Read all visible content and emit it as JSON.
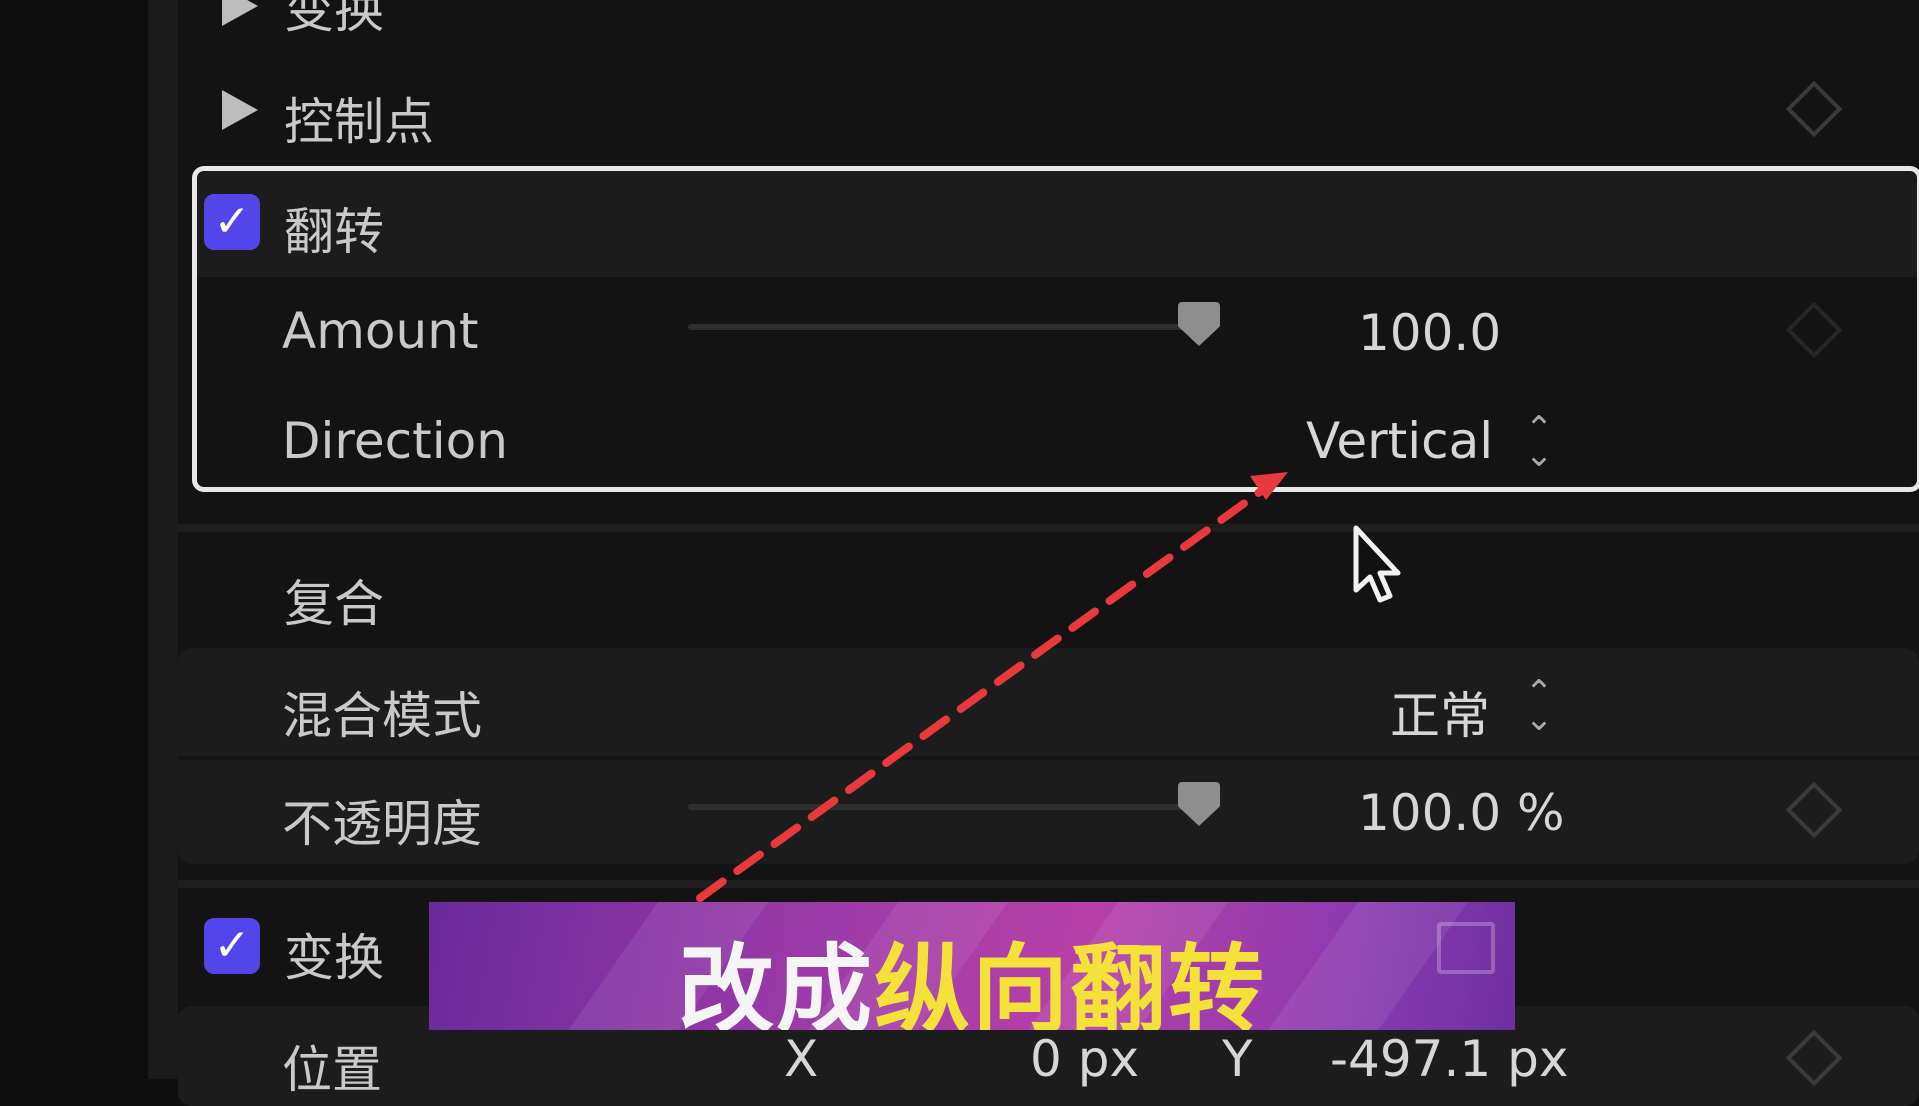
{
  "inspector": {
    "transform_top_label": "变换",
    "control_points_label": "控制点",
    "flip": {
      "title": "翻转",
      "checked": true,
      "amount": {
        "label": "Amount",
        "value": "100.0",
        "slider_level": 1.0
      },
      "direction": {
        "label": "Direction",
        "value": "Vertical"
      }
    },
    "composite": {
      "title": "复合",
      "blend_mode": {
        "label": "混合模式",
        "value": "正常"
      },
      "opacity": {
        "label": "不透明度",
        "value": "100.0 %",
        "slider_level": 1.0
      }
    },
    "transform": {
      "title": "变换",
      "checked": true,
      "position": {
        "label": "位置",
        "x_label": "X",
        "x_value": "0 px",
        "y_label": "Y",
        "y_value": "-497.1 px"
      }
    }
  },
  "caption": {
    "part1": "改成",
    "part2": "纵向翻转"
  },
  "colors": {
    "checkbox": "#5246e8",
    "arrow": "#e8393d",
    "caption_bg": "#a03aa8",
    "caption_highlight": "#f4e23a"
  }
}
